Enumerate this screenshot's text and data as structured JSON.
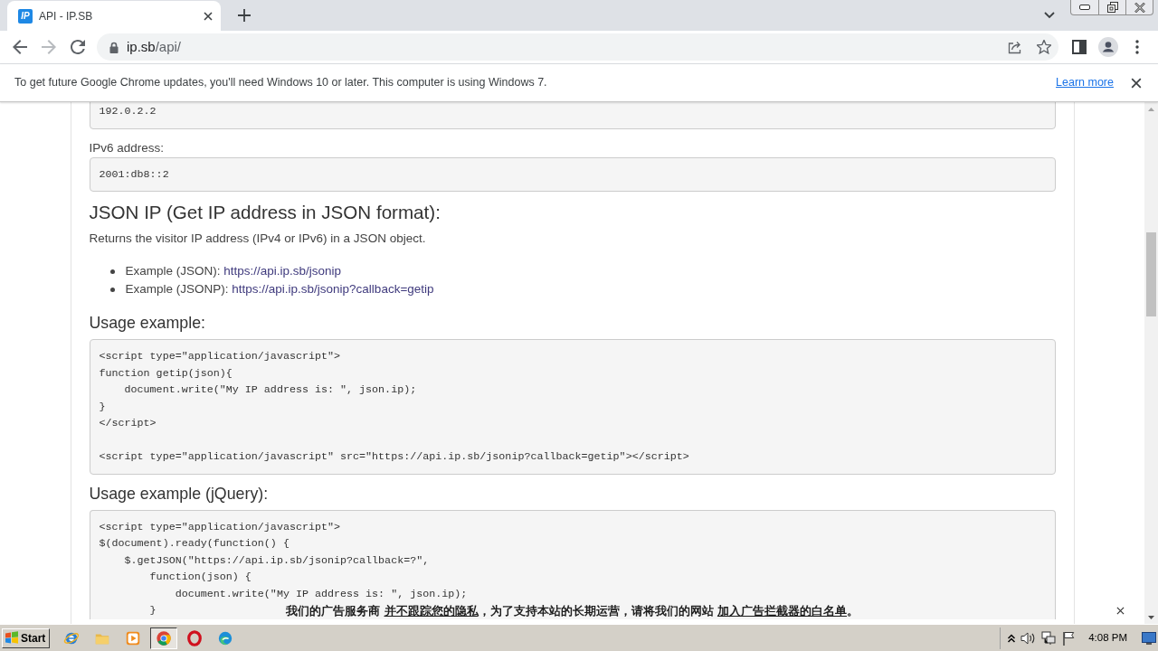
{
  "browser": {
    "tabs": [
      {
        "title": "API - IP.SB",
        "favicon": "IP",
        "selected": true
      }
    ],
    "nav_buttons": [
      {
        "kind": "back",
        "disabled": false
      },
      {
        "kind": "forward",
        "disabled": true
      },
      {
        "kind": "reload",
        "disabled": false
      }
    ],
    "address": {
      "host": "ip.sb",
      "path": "/api/"
    }
  },
  "infobar": {
    "message": "To get future Google Chrome updates, you'll need Windows 10 or later. This computer is using Windows 7.",
    "link": "Learn more"
  },
  "page": {
    "blocks": [
      {
        "kind": "code",
        "text": "192.0.2.2"
      },
      {
        "kind": "label",
        "text": "IPv6 address:"
      },
      {
        "kind": "code",
        "text": "2001:db8::2"
      },
      {
        "kind": "heading",
        "text": "JSON IP (Get IP address in JSON format):"
      },
      {
        "kind": "paragraph",
        "text": "Returns the visitor IP address (IPv4 or IPv6) in a JSON object."
      },
      {
        "kind": "list",
        "items": [
          {
            "label": "Example (JSON):",
            "link": "https://api.ip.sb/jsonip"
          },
          {
            "label": "Example (JSONP):",
            "link": "https://api.ip.sb/jsonip?callback=getip"
          }
        ]
      },
      {
        "kind": "subheading",
        "text": "Usage example:"
      },
      {
        "kind": "code",
        "text": "<script type=\"application/javascript\">\nfunction getip(json){\n    document.write(\"My IP address is: \", json.ip);\n}\n</script>\n\n<script type=\"application/javascript\" src=\"https://api.ip.sb/jsonip?callback=getip\"></script>"
      },
      {
        "kind": "subheading",
        "text": "Usage example (jQuery):"
      },
      {
        "kind": "code",
        "text": "<script type=\"application/javascript\">\n$(document).ready(function() {\n    $.getJSON(\"https://api.ip.sb/jsonip?callback=?\",\n        function(json) {\n            document.write(\"My IP address is: \", json.ip);\n        }"
      }
    ]
  },
  "ad_bar": {
    "segments": [
      {
        "kind": "text",
        "text": "我们的广告服务商 "
      },
      {
        "kind": "link",
        "text": "并不跟踪您的隐私"
      },
      {
        "kind": "text",
        "text": "，为了支持本站的长期运营，请将我们的网站 "
      },
      {
        "kind": "link",
        "text": "加入广告拦截器的白名单"
      },
      {
        "kind": "text",
        "text": "。"
      }
    ]
  },
  "taskbar": {
    "start": "Start",
    "apps": [
      {
        "selected": false
      },
      {
        "selected": false
      },
      {
        "selected": false
      },
      {
        "selected": true
      },
      {
        "selected": false
      },
      {
        "selected": false
      }
    ],
    "clock": "4:08 PM"
  }
}
